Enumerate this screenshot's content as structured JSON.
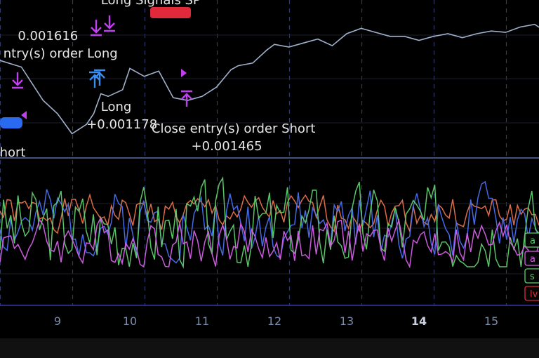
{
  "chart_data": [
    {
      "type": "line",
      "title": "",
      "x_ticks": [
        "9",
        "10",
        "11",
        "12",
        "13",
        "14",
        "15"
      ],
      "bold_tick": "14",
      "price_series": {
        "color": "#9fb1cc",
        "x": [
          -0.8,
          -0.5,
          -0.2,
          0.0,
          0.2,
          0.4,
          0.5,
          0.6,
          0.7,
          0.9,
          1.0,
          1.2,
          1.4,
          1.6,
          1.8,
          2.0,
          2.2,
          2.4,
          2.5,
          2.7,
          2.9,
          3.0,
          3.2,
          3.4,
          3.6,
          3.8,
          4.0,
          4.2,
          4.4,
          4.6,
          4.8,
          5.0,
          5.2,
          5.4,
          5.6,
          5.8,
          6.0,
          6.2,
          6.4,
          6.6,
          6.8,
          7.0
        ],
        "y": [
          6,
          5.5,
          3.0,
          2.0,
          0.5,
          1.2,
          2.0,
          3.5,
          3.3,
          3.8,
          5.4,
          4.8,
          5.2,
          3.2,
          3.0,
          3.3,
          4.0,
          5.3,
          5.6,
          5.8,
          6.8,
          7.2,
          7.0,
          7.3,
          7.6,
          7.1,
          8.0,
          8.4,
          8.1,
          7.8,
          7.8,
          7.5,
          7.8,
          8.0,
          7.7,
          8.0,
          8.2,
          8.1,
          8.5,
          8.7,
          8.0,
          7.6
        ]
      },
      "indicator_series": [
        {
          "name": "a",
          "color": "#e8734a",
          "base": 0.55,
          "amp": 0.18,
          "seed": 1
        },
        {
          "name": "a",
          "color": "#4a6ff0",
          "base": 0.45,
          "amp": 0.35,
          "seed": 2
        },
        {
          "name": "s",
          "color": "#5fcf6f",
          "base": 0.4,
          "amp": 0.45,
          "seed": 3
        },
        {
          "name": "l",
          "color": "#d65fe8",
          "base": 0.25,
          "amp": 0.25,
          "seed": 4
        }
      ],
      "legend_tags": [
        "a",
        "a",
        "s",
        "lv"
      ],
      "annotations": [
        {
          "text": "Long Signals SP",
          "x": 0.6,
          "row": 0
        },
        {
          "text": "0.001616",
          "x": -0.55,
          "row": 1
        },
        {
          "text": "ntry(s) order Long",
          "x": -0.75,
          "row": 2
        },
        {
          "text": "Long",
          "x": 0.6,
          "row": 3
        },
        {
          "text": "+0.001178",
          "x": 0.4,
          "row": 4
        },
        {
          "text": "Close entry(s) order Short",
          "x": 1.3,
          "row": 5
        },
        {
          "text": "+0.001465",
          "x": 1.85,
          "row": 6
        },
        {
          "text": "hort",
          "x": -0.8,
          "row": 7
        }
      ]
    }
  ]
}
